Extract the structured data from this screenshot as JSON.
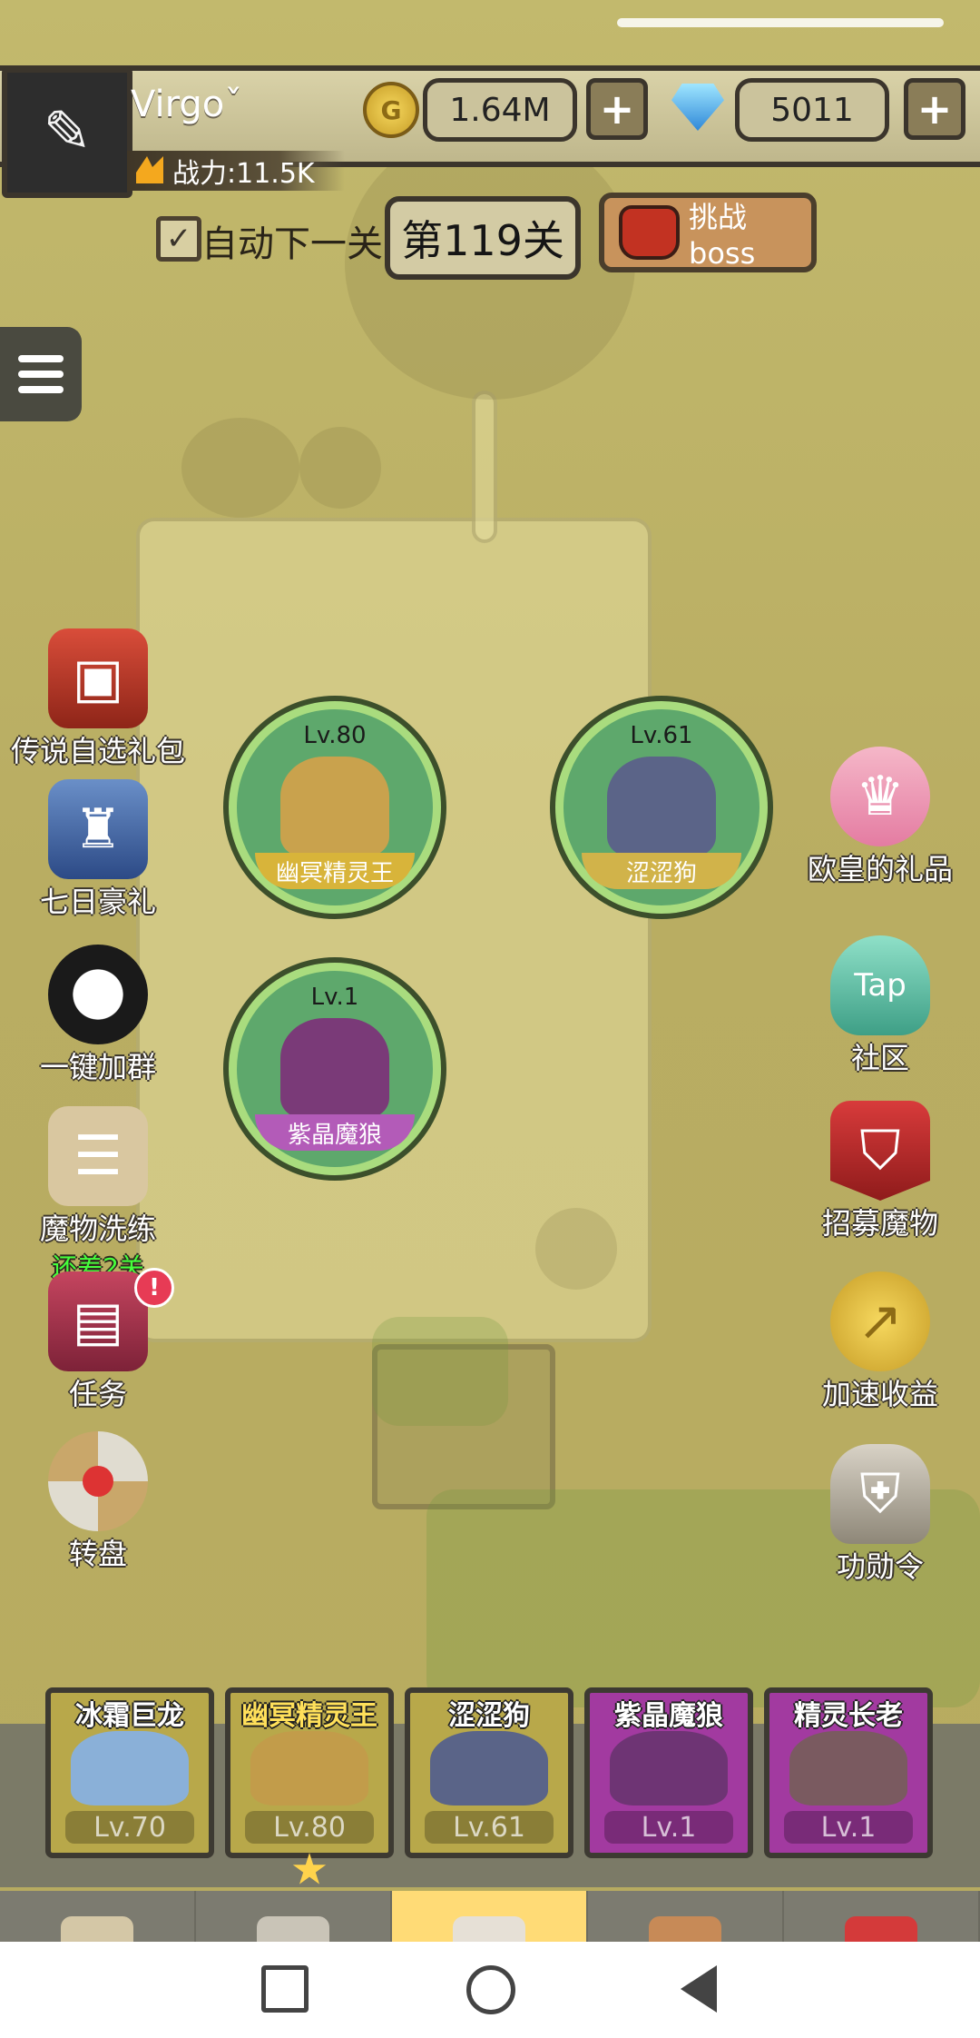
{
  "player": {
    "name": "Virgoˇ",
    "power": "战力:11.5K"
  },
  "currency": {
    "coins": "1.64M",
    "gems": "5011"
  },
  "stage": {
    "auto_next": "自动下一关",
    "current": "第119关",
    "boss_button": "挑战boss"
  },
  "side_left": [
    {
      "label": "传说自选礼包"
    },
    {
      "label": "七日豪礼"
    },
    {
      "label": "一键加群"
    },
    {
      "label": "魔物洗练",
      "sub": "还差2关"
    },
    {
      "label": "任务",
      "badge": "!"
    },
    {
      "label": "转盘"
    }
  ],
  "side_right": [
    {
      "label": "欧皇的礼品"
    },
    {
      "label": "社区",
      "icon_text": "Tap"
    },
    {
      "label": "招募魔物"
    },
    {
      "label": "加速收益"
    },
    {
      "label": "功勋令"
    }
  ],
  "map_monsters": [
    {
      "level": "Lv.80",
      "name": "幽冥精灵王",
      "name_color": "#d8b43a",
      "art_color": "#c9a24d"
    },
    {
      "level": "Lv.61",
      "name": "涩涩狗",
      "name_color": "#d1b34a",
      "art_color": "#5b6488"
    },
    {
      "level": "Lv.1",
      "name": "紫晶魔狼",
      "name_color": "#b35bb8",
      "art_color": "#7a3a78"
    }
  ],
  "party": [
    {
      "name": "冰霜巨龙",
      "level": "Lv.70",
      "bg": "#b8a84a",
      "art": "#8ab0d8"
    },
    {
      "name": "幽冥精灵王",
      "level": "Lv.80",
      "bg": "#b8a84a",
      "art": "#c29c4a"
    },
    {
      "name": "涩涩狗",
      "level": "Lv.61",
      "bg": "#b8a84a",
      "art": "#5a6488"
    },
    {
      "name": "紫晶魔狼",
      "level": "Lv.1",
      "bg": "#a23aa0",
      "art": "#6e3474"
    },
    {
      "name": "精灵长老",
      "level": "Lv.1",
      "bg": "#a23aa0",
      "art": "#7a5a60"
    }
  ]
}
